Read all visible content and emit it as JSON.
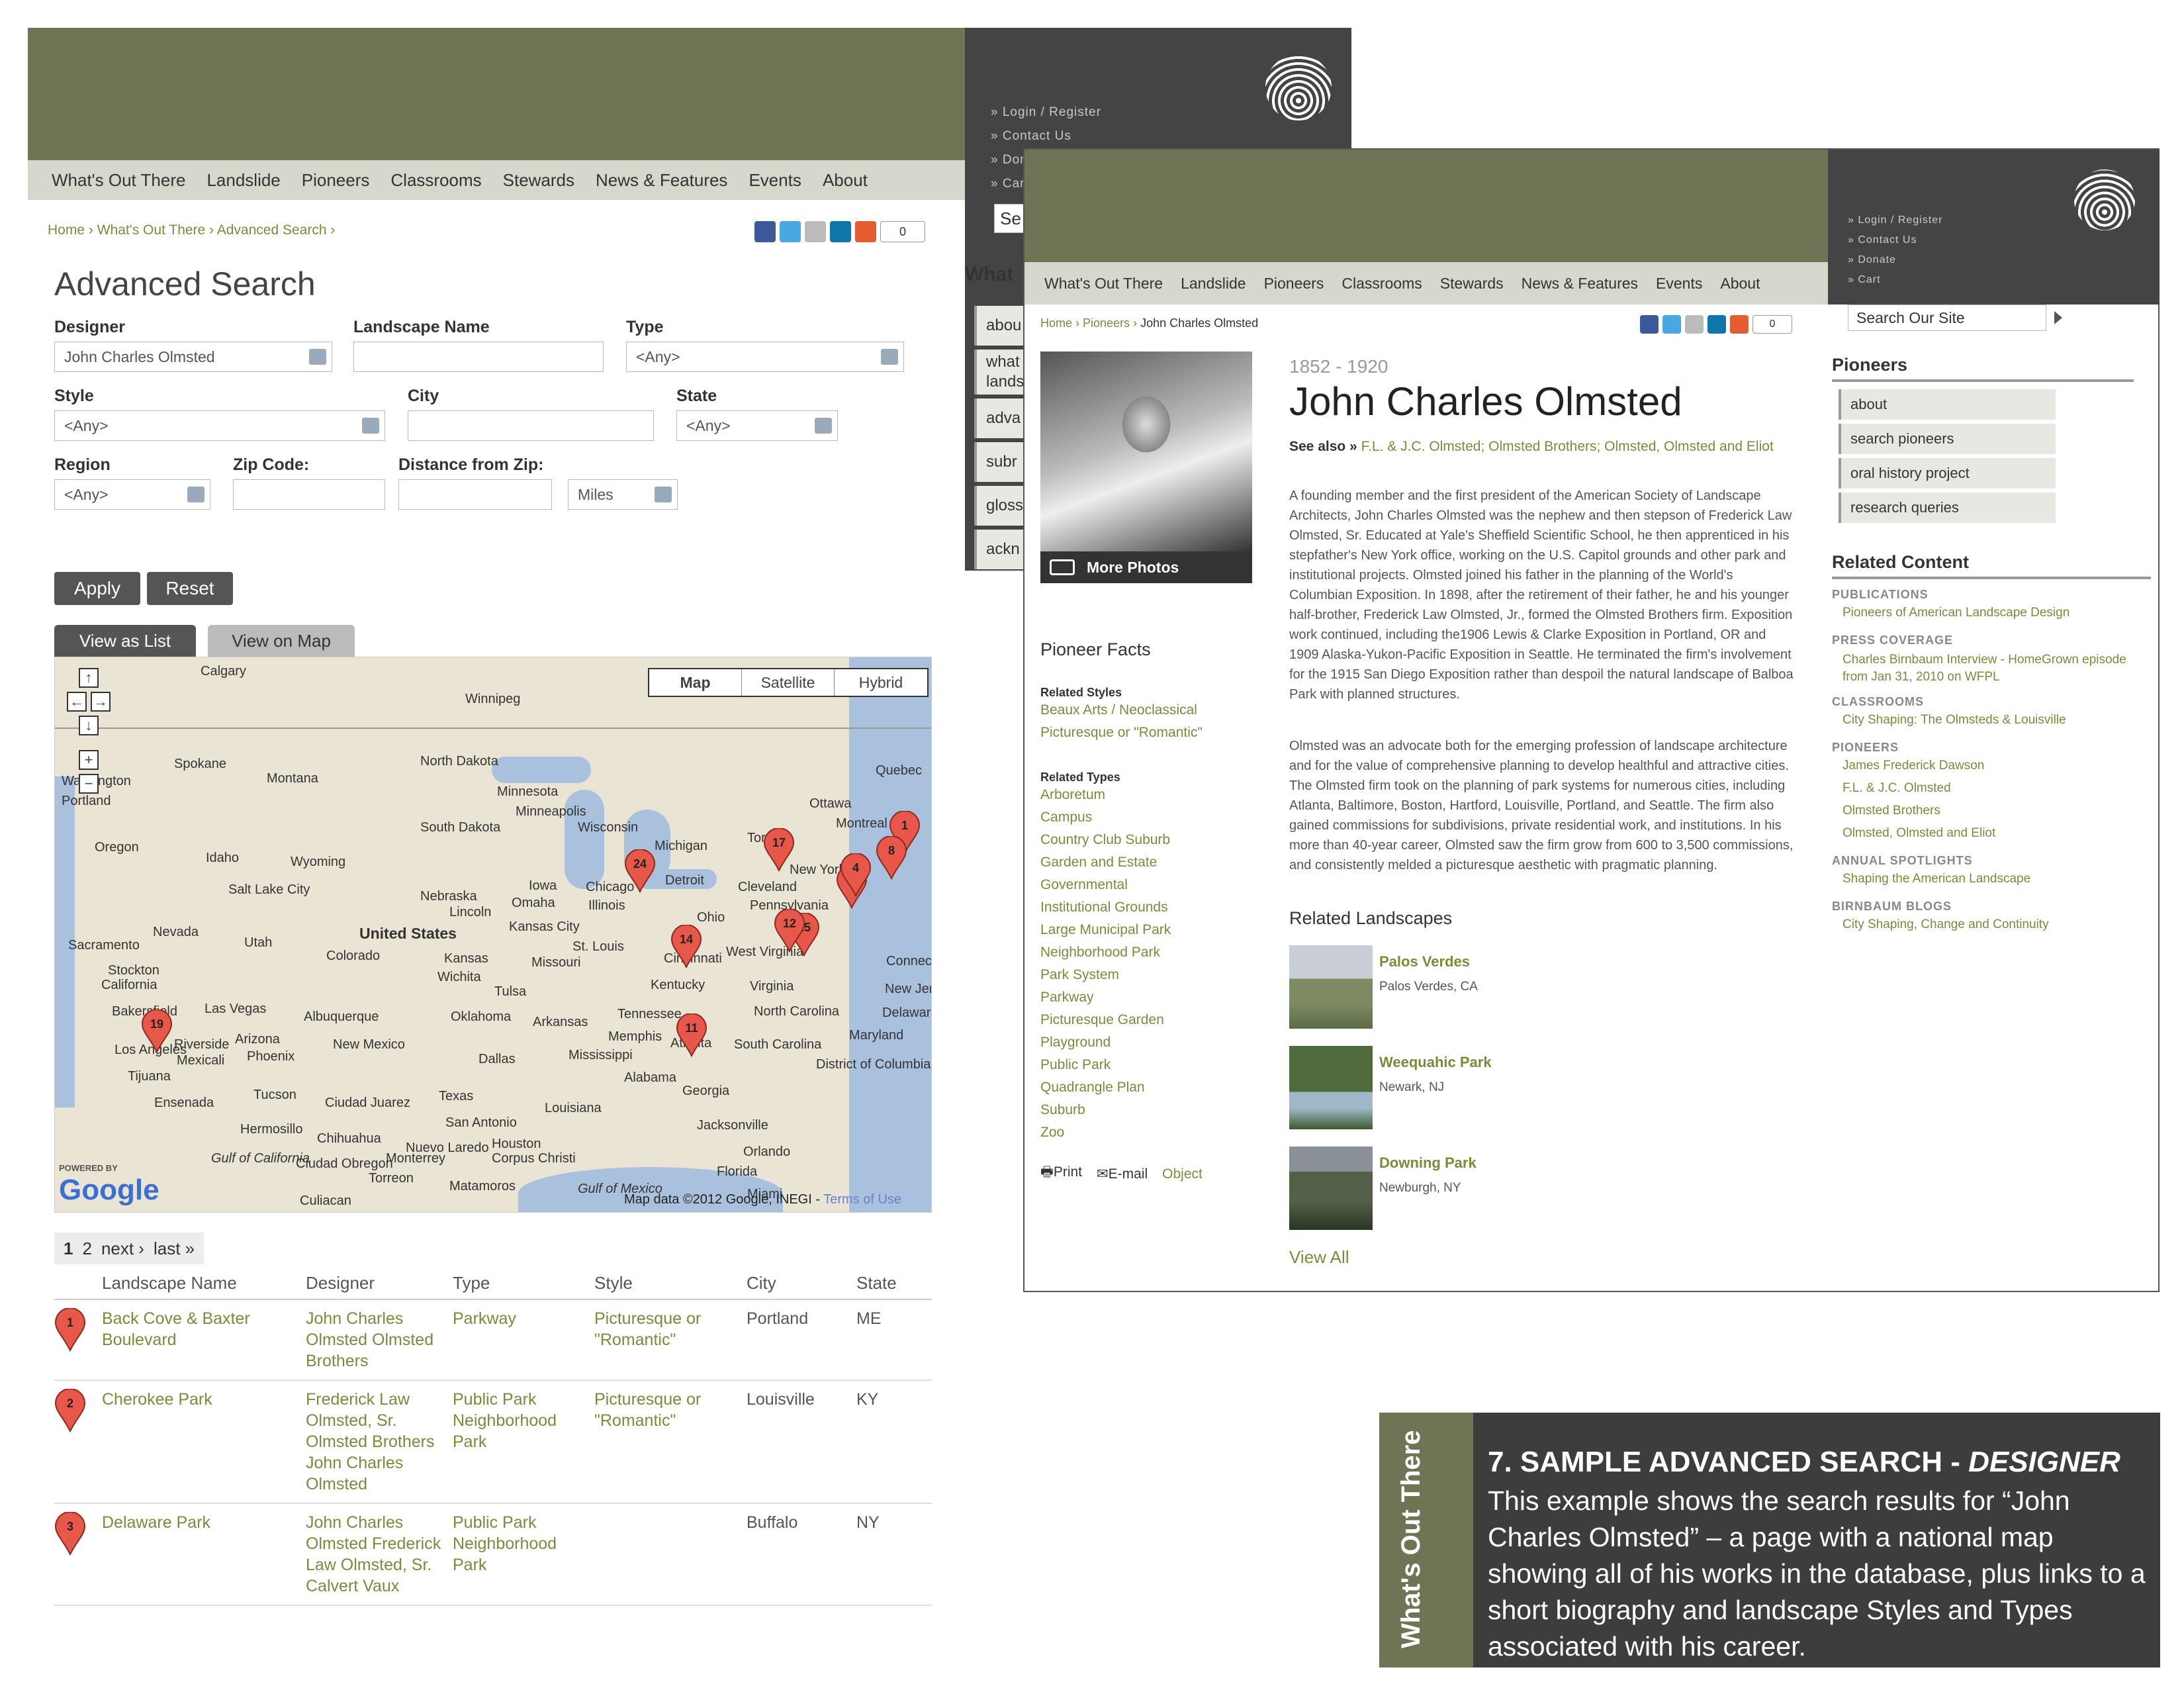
{
  "back_page": {
    "util_links": [
      "» Login / Register",
      "» Contact Us",
      "» Donate",
      "» Cart"
    ],
    "nav": [
      "What's Out There",
      "Landslide",
      "Pioneers",
      "Classrooms",
      "Stewards",
      "News & Features",
      "Events",
      "About"
    ],
    "breadcrumb": [
      "Home",
      "What's Out There",
      "Advanced Search"
    ],
    "share_count": "0",
    "search_stub": "Se",
    "sidebar_stub": {
      "title": "What",
      "items": [
        "abou",
        "what lands",
        "adva",
        "subr",
        "gloss",
        "ackn"
      ]
    },
    "title": "Advanced Search",
    "form": {
      "designer_label": "Designer",
      "designer_value": "John Charles Olmsted",
      "landscape_label": "Landscape Name",
      "landscape_value": "",
      "type_label": "Type",
      "type_value": "<Any>",
      "style_label": "Style",
      "style_value": "<Any>",
      "city_label": "City",
      "city_value": "",
      "state_label": "State",
      "state_value": "<Any>",
      "region_label": "Region",
      "region_value": "<Any>",
      "zip_label": "Zip Code:",
      "zip_value": "",
      "distance_label": "Distance from Zip:",
      "distance_value": "",
      "units_value": "Miles",
      "apply": "Apply",
      "reset": "Reset"
    },
    "tabs": {
      "list": "View as List",
      "map": "View on Map"
    },
    "map": {
      "types": [
        "Map",
        "Satellite",
        "Hybrid"
      ],
      "labels": [
        "Calgary",
        "Winnipeg",
        "Quebec",
        "Ottawa",
        "Montreal",
        "Spokane",
        "Montana",
        "North Dakota",
        "Minnesota",
        "Minneapolis",
        "Wisconsin",
        "Michigan",
        "Toronto",
        "Oregon",
        "Idaho",
        "Wyoming",
        "South Dakota",
        "Portland",
        "Salt Lake City",
        "Nebraska",
        "Lincoln",
        "Omaha",
        "Iowa",
        "Chicago",
        "Illinois",
        "Detroit",
        "Cleveland",
        "Ohio",
        "Pennsylvania",
        "New York",
        "Nevada",
        "Utah",
        "Colorado",
        "United States",
        "Kansas",
        "Kansas City",
        "Missouri",
        "St. Louis",
        "Cincinnati",
        "West Virginia",
        "Virginia",
        "Sacramento",
        "Stockton",
        "California",
        "Las Vegas",
        "Wichita",
        "Tulsa",
        "Oklahoma",
        "Arkansas",
        "Kentucky",
        "Tennessee",
        "North Carolina",
        "Bakersfield",
        "Los Angeles",
        "Riverside",
        "Mexicali",
        "Tijuana",
        "Ensenada",
        "Arizona",
        "Phoenix",
        "Albuquerque",
        "New Mexico",
        "Dallas",
        "Memphis",
        "Mississippi",
        "Alabama",
        "Atlanta",
        "Georgia",
        "South Carolina",
        "Tucson",
        "Ciudad Juarez",
        "Texas",
        "San Antonio",
        "Houston",
        "Louisiana",
        "Jacksonville",
        "Orlando",
        "Florida",
        "Hermosillo",
        "Chihuahua",
        "Nuevo Laredo",
        "Corpus Christi",
        "Gulf of California",
        "Ciudad Obregon",
        "Torreon",
        "Matamoros",
        "Miami",
        "Gulf of Mexico",
        "Culiacan",
        "Monterrey",
        "Maryland",
        "Delaware",
        "District of Columbia",
        "Washington",
        "Connecticut",
        "New Jersey"
      ],
      "markers": [
        "1",
        "8",
        "7",
        "4",
        "17",
        "24",
        "25",
        "12",
        "14",
        "11",
        "19"
      ],
      "attribution": "Map data ©2012 Google, INEGI -",
      "terms": "Terms of Use",
      "powered": "POWERED BY",
      "logo": "Google"
    },
    "pager": {
      "current": "1",
      "page2": "2",
      "next": "next ›",
      "last": "last »"
    },
    "table": {
      "headers": [
        "Landscape Name",
        "Designer",
        "Type",
        "Style",
        "City",
        "State"
      ],
      "rows": [
        {
          "marker": "1",
          "name": "Back Cove & Baxter Boulevard",
          "designer": "John Charles Olmsted Olmsted Brothers",
          "type": "Parkway",
          "style": "Picturesque or \"Romantic\"",
          "city": "Portland",
          "state": "ME"
        },
        {
          "marker": "2",
          "name": "Cherokee Park",
          "designer": "Frederick Law Olmsted, Sr. Olmsted Brothers John Charles Olmsted",
          "type": "Public Park Neighborhood Park",
          "style": "Picturesque or \"Romantic\"",
          "city": "Louisville",
          "state": "KY"
        },
        {
          "marker": "3",
          "name": "Delaware Park",
          "designer": "John Charles Olmsted Frederick Law Olmsted, Sr. Calvert Vaux",
          "type": "Public Park Neighborhood Park",
          "style": "",
          "city": "Buffalo",
          "state": "NY"
        }
      ]
    }
  },
  "front_page": {
    "util_links": [
      "» Login / Register",
      "» Contact Us",
      "» Donate",
      "» Cart"
    ],
    "nav": [
      "What's Out There",
      "Landslide",
      "Pioneers",
      "Classrooms",
      "Stewards",
      "News & Features",
      "Events",
      "About"
    ],
    "search_placeholder": "Search Our Site",
    "breadcrumb": [
      "Home",
      "Pioneers",
      "John Charles Olmsted"
    ],
    "share_count": "0",
    "more_photos": "More Photos",
    "years": "1852 - 1920",
    "name": "John Charles Olmsted",
    "see_also_label": "See also »",
    "see_also": "F.L. & J.C. Olmsted; Olmsted Brothers; Olmsted, Olmsted and Eliot",
    "bio1": "A founding member and the first president of the American Society of Landscape Architects, John Charles Olmsted was the nephew and then stepson of Frederick Law Olmsted, Sr. Educated at Yale's Sheffield Scientific School, he then apprenticed in his stepfather's New York office, working on the U.S. Capitol grounds and other park and institutional projects. Olmsted joined his father in the planning of the World's Columbian Exposition. In 1898, after the retirement of their father, he and his younger half-brother, Frederick Law Olmsted, Jr., formed the Olmsted Brothers firm. Exposition work continued, including the1906 Lewis & Clarke Exposition in Portland, OR and 1909 Alaska-Yukon-Pacific Exposition in Seattle. He terminated the firm's involvement for the 1915 San Diego Exposition rather than despoil the natural landscape of Balboa Park with planned structures.",
    "bio2": "Olmsted was an advocate both for the emerging profession of landscape architecture and for the value of comprehensive planning to develop healthful and attractive cities. The Olmsted firm took on the planning of park systems for numerous cities, including Atlanta, Baltimore, Boston, Hartford, Louisville, Portland, and Seattle. The firm also gained commissions for subdivisions, private residential work, and institutions. In his more than 40-year career, Olmsted saw the firm grow from 600 to 3,500 commissions, and consistently melded a picturesque aesthetic with pragmatic planning.",
    "facts_title": "Pioneer Facts",
    "styles_label": "Related Styles",
    "styles": [
      "Beaux Arts / Neoclassical",
      "Picturesque or \"Romantic\""
    ],
    "types_label": "Related Types",
    "types": [
      "Arboretum",
      "Campus",
      "Country Club Suburb",
      "Garden and Estate",
      "Governmental",
      "Institutional Grounds",
      "Large Municipal Park",
      "Neighborhood Park",
      "Park System",
      "Parkway",
      "Picturesque Garden",
      "Playground",
      "Public Park",
      "Quadrangle Plan",
      "Suburb",
      "Zoo"
    ],
    "print": "Print",
    "email": "E-mail",
    "object": "Object",
    "related_landscapes_title": "Related Landscapes",
    "landscapes": [
      {
        "name": "Palos Verdes",
        "loc": "Palos Verdes, CA"
      },
      {
        "name": "Weequahic Park",
        "loc": "Newark, NJ"
      },
      {
        "name": "Downing Park",
        "loc": "Newburgh, NY"
      }
    ],
    "view_all": "View All",
    "sidebar_title": "Pioneers",
    "sidebar_items": [
      "about",
      "search pioneers",
      "oral history project",
      "research queries"
    ],
    "related_title": "Related Content",
    "related": [
      {
        "head": "PUBLICATIONS",
        "links": [
          "Pioneers of American Landscape Design"
        ]
      },
      {
        "head": "PRESS COVERAGE",
        "links": [
          "Charles Birnbaum Interview - HomeGrown episode from Jan 31, 2010 on WFPL"
        ]
      },
      {
        "head": "CLASSROOMS",
        "links": [
          "City Shaping: The Olmsteds & Louisville"
        ]
      },
      {
        "head": "PIONEERS",
        "links": [
          "James Frederick Dawson",
          "F.L. & J.C. Olmsted",
          "Olmsted Brothers",
          "Olmsted, Olmsted and Eliot"
        ]
      },
      {
        "head": "ANNUAL SPOTLIGHTS",
        "links": [
          "Shaping the American Landscape"
        ]
      },
      {
        "head": "BIRNBAUM BLOGS",
        "links": [
          "City Shaping, Change and Continuity"
        ]
      }
    ]
  },
  "caption": {
    "vertical": "What's Out There",
    "title_prefix": "7. SAMPLE ADVANCED SEARCH -",
    "title_em": "DESIGNER",
    "body": "This example shows the search results for “John Charles Olmsted” – a page with a national map showing all of his works in the database, plus links to a short biography and landscape Styles and Types associated with his career."
  },
  "colors": {
    "olive": "#6e7454",
    "dark": "#444444",
    "link": "#7c8a3c",
    "marker": "#e8584a"
  }
}
